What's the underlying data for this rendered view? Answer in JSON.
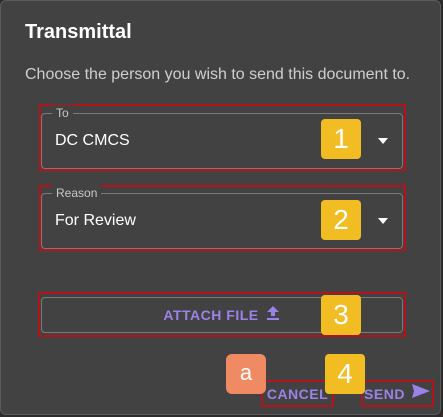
{
  "dialog": {
    "title": "Transmittal",
    "subtitle": "Choose the person you wish to send this document to."
  },
  "to_field": {
    "label": "To",
    "value": "DC CMCS"
  },
  "reason_field": {
    "label": "Reason",
    "value": "For Review"
  },
  "attach": {
    "label": "ATTACH FILE"
  },
  "actions": {
    "cancel_label": "CANCEL",
    "send_label": "SEND"
  },
  "annotations": {
    "badge_1": "1",
    "badge_2": "2",
    "badge_3": "3",
    "badge_4": "4",
    "badge_a": "a"
  },
  "icons": {
    "dropdown": "chevron-down-icon",
    "attach": "upload-icon",
    "send": "send-icon"
  },
  "colors": {
    "accent": "#9b82e8",
    "highlight": "#b3141c",
    "badge": "#f2bd22",
    "badge_alt": "#f08a63",
    "surface": "#424242"
  }
}
